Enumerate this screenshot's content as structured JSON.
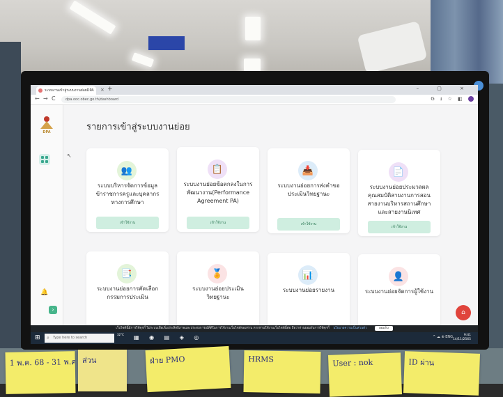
{
  "browser": {
    "tab_title": "ระบบงานเข้าสู่ระบบงานย่อยDPA",
    "tab_close": "×",
    "tab_new": "+",
    "window_controls": "– ▢ ×",
    "nav_back": "←",
    "nav_forward": "→",
    "nav_reload": "C",
    "url": "dpa.ooc.obec.go.th/dashboard",
    "toolbar_icons": "G ⭳ ☆ ◧"
  },
  "sidebar": {
    "logo_text": "DPA",
    "expand_label": "›"
  },
  "page": {
    "title": "รายการเข้าสู่ระบบงานย่อย"
  },
  "cards": [
    {
      "label": "ระบบบริหารจัดการข้อมูลข้าราชการครูและบุคลากรทางการศึกษา",
      "button": "เข้าใช้งาน",
      "icon": "users-icon",
      "icon_bg": "#e3f4d9",
      "icon_color": "#6ab04c",
      "glyph": "👥"
    },
    {
      "label": "ระบบงานย่อยข้อตกลงในการพัฒนางาน(Performance Agreement PA)",
      "button": "เข้าใช้งาน",
      "icon": "clipboard-icon",
      "icon_bg": "#efe0f7",
      "icon_color": "#9b59b6",
      "glyph": "📋"
    },
    {
      "label": "ระบบงานย่อยการส่งคำขอประเมินวิทยฐานะ",
      "button": "เข้าใช้งาน",
      "icon": "inbox-icon",
      "icon_bg": "#dcecf9",
      "icon_color": "#2e86de",
      "glyph": "📥"
    },
    {
      "label": "ระบบงานย่อยประมวลผลคุณสมบัติสายงานการสอน สายงานบริหารสถานศึกษา และสายงานนิเทศ",
      "button": "เข้าใช้งาน",
      "icon": "document-icon",
      "icon_bg": "#efe0f7",
      "icon_color": "#8e44ad",
      "glyph": "📄"
    },
    {
      "label": "ระบบงานย่อยการคัดเลือกกรรมการประเมิน",
      "button": "",
      "icon": "file-list-icon",
      "icon_bg": "#e3f4d9",
      "icon_color": "#27ae60",
      "glyph": "📑"
    },
    {
      "label": "ระบบงานย่อยประเมินวิทยฐานะ",
      "button": "",
      "icon": "badge-icon",
      "icon_bg": "#fbe3e4",
      "icon_color": "#e74c3c",
      "glyph": "🏅"
    },
    {
      "label": "ระบบงานย่อยรายงาน",
      "button": "",
      "icon": "chart-report-icon",
      "icon_bg": "#dcecf9",
      "icon_color": "#2e86de",
      "glyph": "📊"
    },
    {
      "label": "ระบบงานย่อยจัดการผู้ใช้งาน",
      "button": "",
      "icon": "user-settings-icon",
      "icon_bg": "#fbe3e4",
      "icon_color": "#e74c3c",
      "glyph": "👤"
    }
  ],
  "cookie_bar": {
    "text": "เว็บไซต์นี้มีการใช้คุกกี้ ไม่ระบบเพื่อเพิ่มประสิทธิภาพและประสบการณ์ที่ดีในการใช้งานเว็บไซต์ของท่าน หากท่านใช้งานเว็บไซต์นี้ต่อ ถือว่าท่านยอมรับการใช้คุกกี้",
    "link": "นโยบายความเป็นส่วนตัว",
    "accept": "ยอมรับ"
  },
  "taskbar": {
    "start_icon": "⊞",
    "search_placeholder": "Type here to search",
    "weather": "32°C",
    "apps": "▦ ◉ ▤ ◈ ◎",
    "tray": "^ ☁ ⊕ ENG",
    "time": "9:41",
    "date": "14/11/2565"
  },
  "fab_icon": "⌂",
  "sticky_notes": [
    "1 พ.ค. 68 - 31 พ.ค. 69",
    "ส่วน",
    "ฝ่าย PMO",
    "HRMS",
    "User : nok",
    "ID ผ่าน"
  ]
}
